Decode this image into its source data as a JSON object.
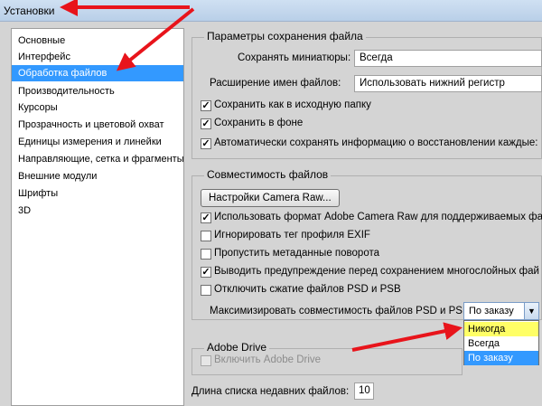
{
  "window": {
    "title": "Установки"
  },
  "sidebar": {
    "items": [
      {
        "label": "Основные"
      },
      {
        "label": "Интерфейс"
      },
      {
        "label": "Обработка файлов",
        "selected": true
      },
      {
        "label": "Производительность"
      },
      {
        "label": "Курсоры"
      },
      {
        "label": "Прозрачность и цветовой охват"
      },
      {
        "label": "Единицы измерения и линейки"
      },
      {
        "label": "Направляющие, сетка и фрагменты"
      },
      {
        "label": "Внешние модули"
      },
      {
        "label": "Шрифты"
      },
      {
        "label": "3D"
      }
    ]
  },
  "save_options": {
    "group_title": "Параметры сохранения файла",
    "thumbnails_label": "Сохранять миниатюры:",
    "thumbnails_value": "Всегда",
    "extension_label": "Расширение имен файлов:",
    "extension_value": "Использовать нижний регистр",
    "save_as_original": {
      "label": "Сохранить как в исходную папку",
      "checked": true
    },
    "save_background": {
      "label": "Сохранить в фоне",
      "checked": true
    },
    "autosave": {
      "label": "Автоматически сохранять информацию о восстановлении каждые:",
      "checked": true
    }
  },
  "compatibility": {
    "group_title": "Совместимость файлов",
    "camera_raw_button": "Настройки Camera Raw...",
    "use_acr": {
      "label": "Использовать формат Adobe Camera Raw для поддерживаемых фай",
      "checked": true
    },
    "ignore_exif": {
      "label": "Игнорировать тег профиля EXIF",
      "checked": false
    },
    "skip_rotation": {
      "label": "Пропустить метаданные поворота",
      "checked": false
    },
    "warn_layered": {
      "label": "Выводить предупреждение перед сохранением многослойных фай",
      "checked": true
    },
    "disable_compression": {
      "label": "Отключить сжатие файлов PSD и PSB",
      "checked": false
    },
    "maximize_label": "Максимизировать совместимость файлов PSD и PSB:",
    "maximize_value": "По заказу",
    "maximize_options": [
      "Никогда",
      "Всегда",
      "По заказу"
    ]
  },
  "adobe_drive": {
    "group_title": "Adobe Drive",
    "enable": {
      "label": "Включить Adobe Drive",
      "checked": false
    }
  },
  "recent_files": {
    "label": "Длина списка недавних файлов:",
    "value": "10"
  },
  "colors": {
    "selection": "#3399ff",
    "highlight": "#ffff66",
    "annotation_arrow": "#e8141b"
  }
}
